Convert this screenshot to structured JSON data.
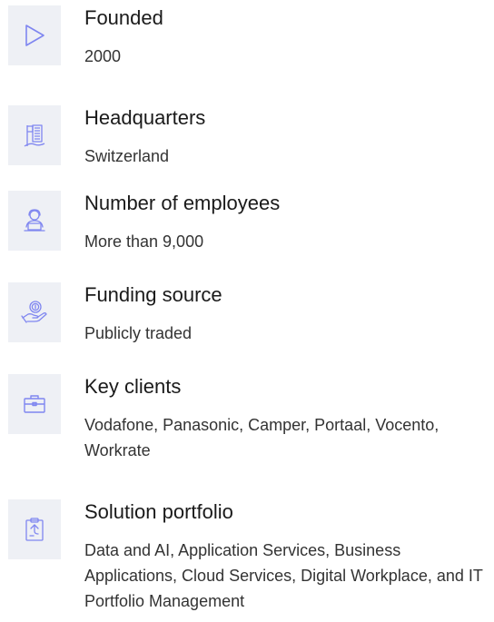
{
  "accent_color": "#7f86f0",
  "items": [
    {
      "icon": "play-triangle-icon",
      "title": "Founded",
      "value": "2000"
    },
    {
      "icon": "building-flag-icon",
      "title": "Headquarters",
      "value": "Switzerland"
    },
    {
      "icon": "employee-laptop-icon",
      "title": "Number of employees",
      "value": "More than 9,000"
    },
    {
      "icon": "hand-coin-icon",
      "title": "Funding source",
      "value": "Publicly traded"
    },
    {
      "icon": "briefcase-icon",
      "title": "Key clients",
      "value": "Vodafone, Panasonic, Camper, Portaal, Vocento, Workrate"
    },
    {
      "icon": "clipboard-icon",
      "title": "Solution portfolio",
      "value": "Data and AI, Application Services, Business Applications, Cloud Services, Digital Workplace, and IT Portfolio Management"
    }
  ]
}
